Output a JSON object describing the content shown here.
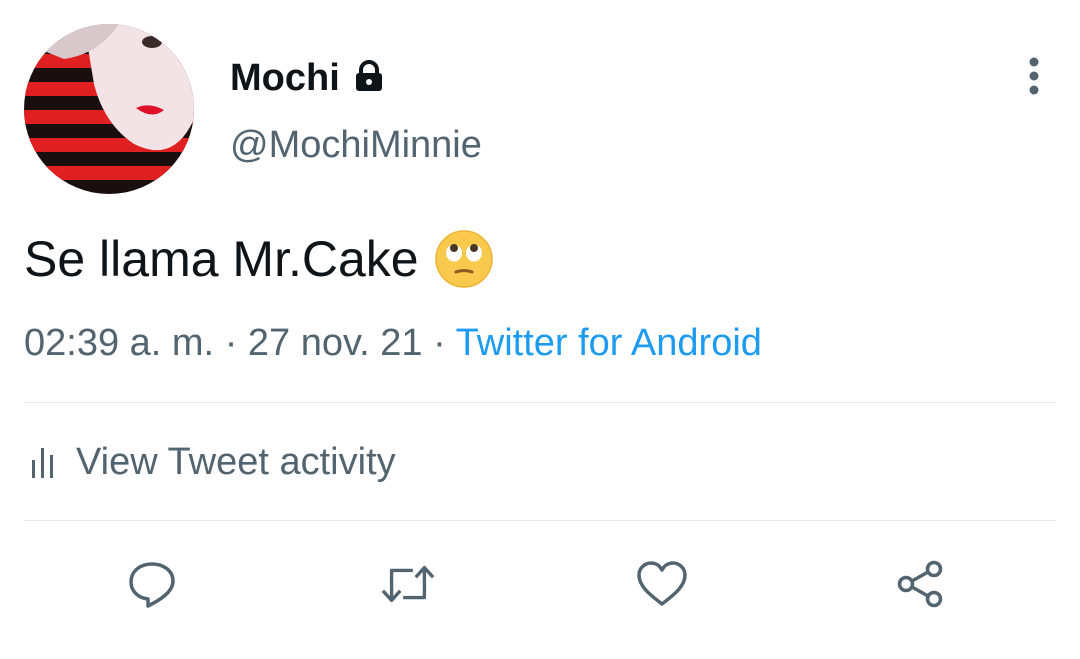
{
  "tweet": {
    "author": {
      "display_name": "Mochi",
      "handle": "@MochiMinnie",
      "protected_icon": "lock-icon"
    },
    "text": "Se llama Mr.Cake",
    "emoji": "face-with-rolling-eyes",
    "time": "02:39 a. m.",
    "date": "27 nov. 21",
    "separator": "·",
    "source": "Twitter for Android",
    "activity_label": "View Tweet activity",
    "actions": [
      "reply-icon",
      "retweet-icon",
      "like-icon",
      "share-icon"
    ],
    "more_icon": "more-vertical-icon"
  },
  "colors": {
    "text": "#0f1419",
    "secondary": "#536471",
    "link": "#1d9bf0",
    "divider": "#e6e9ec"
  }
}
